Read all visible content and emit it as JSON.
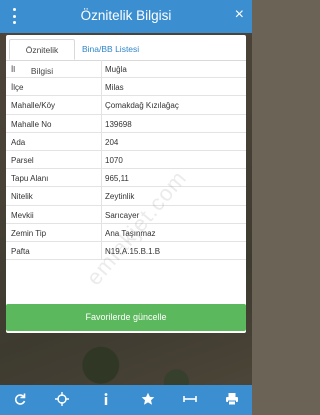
{
  "header": {
    "title": "Öznitelik Bilgisi",
    "close_icon": "×"
  },
  "tabs": [
    {
      "label": "Öznitelik Bilgisi"
    },
    {
      "label": "Bina/BB Listesi"
    }
  ],
  "rows": [
    {
      "label": "İl",
      "value": "Muğla"
    },
    {
      "label": "İlçe",
      "value": "Milas"
    },
    {
      "label": "Mahalle/Köy",
      "value": "Çomakdağ Kızılağaç"
    },
    {
      "label": "Mahalle No",
      "value": "139698"
    },
    {
      "label": "Ada",
      "value": "204"
    },
    {
      "label": "Parsel",
      "value": "1070"
    },
    {
      "label": "Tapu Alanı",
      "value": "965,11"
    },
    {
      "label": "Nitelik",
      "value": "Zeytinlik"
    },
    {
      "label": "Mevkii",
      "value": "Sarıcayer"
    },
    {
      "label": "Zemin Tip",
      "value": "Ana Taşınmaz"
    },
    {
      "label": "Pafta",
      "value": "N19.A.15.B.1.B"
    }
  ],
  "favorite_button": {
    "label": "Favorilerde güncelle"
  },
  "watermark": "emlakjet.com",
  "bottom_bar": {
    "icons": [
      "refresh-icon",
      "crosshair-icon",
      "info-icon",
      "star-icon",
      "measure-icon",
      "print-icon"
    ]
  },
  "colors": {
    "header": "#3b8fd0",
    "favorite": "#5cb85c",
    "tab_link": "#2f86c9"
  }
}
